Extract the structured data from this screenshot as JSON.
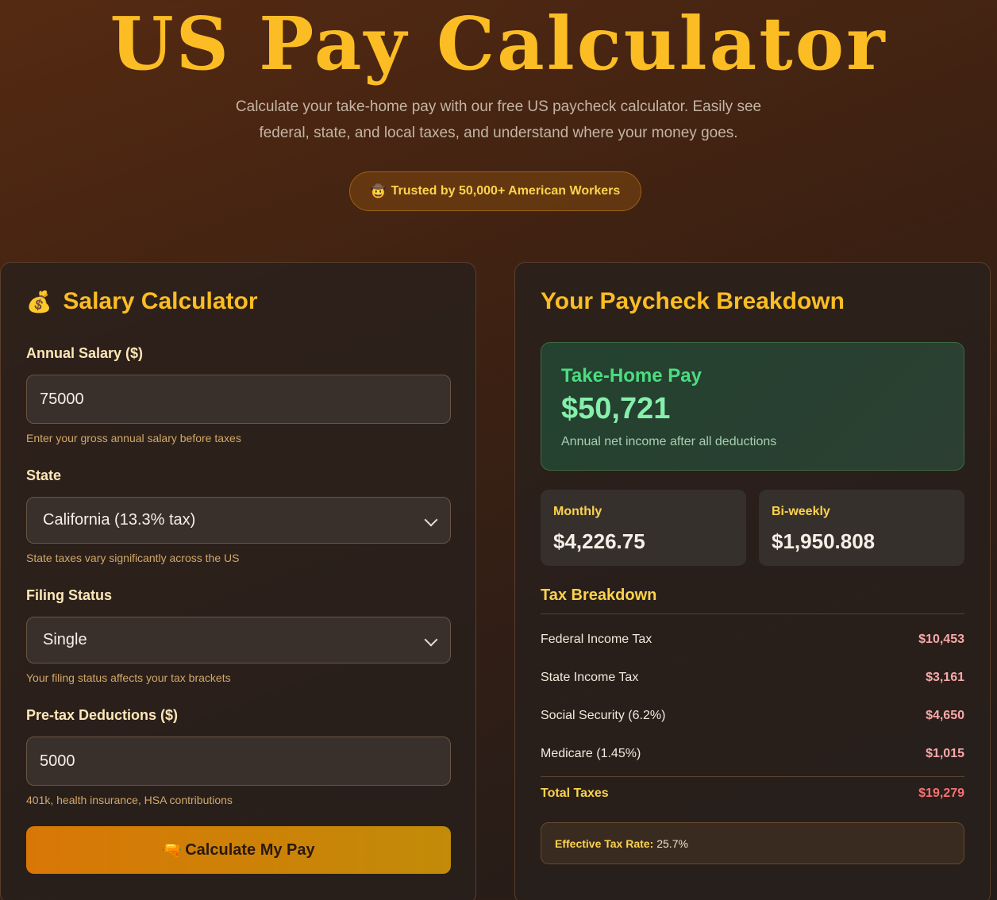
{
  "hero": {
    "title": "US Pay Calculator",
    "subtitle": "Calculate your take-home pay with our free US paycheck calculator. Easily see federal, state, and local taxes, and understand where your money goes.",
    "badge_icon": "🤠",
    "badge_text": "Trusted by 50,000+ American Workers"
  },
  "calculator": {
    "icon": "💰",
    "title": "Salary Calculator",
    "salary": {
      "label": "Annual Salary ($)",
      "value": "75000",
      "hint": "Enter your gross annual salary before taxes"
    },
    "state": {
      "label": "State",
      "selected": "California (13.3% tax)",
      "hint": "State taxes vary significantly across the US"
    },
    "filing": {
      "label": "Filing Status",
      "selected": "Single",
      "hint": "Your filing status affects your tax brackets"
    },
    "deductions": {
      "label": "Pre-tax Deductions ($)",
      "value": "5000",
      "hint": "401k, health insurance, HSA contributions"
    },
    "button_icon": "🔫",
    "button_label": "Calculate My Pay"
  },
  "breakdown": {
    "title": "Your Paycheck Breakdown",
    "takehome": {
      "label": "Take-Home Pay",
      "value": "$50,721",
      "desc": "Annual net income after all deductions"
    },
    "monthly": {
      "label": "Monthly",
      "value": "$4,226.75"
    },
    "biweekly": {
      "label": "Bi-weekly",
      "value": "$1,950.808"
    },
    "tax_title": "Tax Breakdown",
    "taxes": [
      {
        "label": "Federal Income Tax",
        "amount": "$10,453"
      },
      {
        "label": "State Income Tax",
        "amount": "$3,161"
      },
      {
        "label": "Social Security (6.2%)",
        "amount": "$4,650"
      },
      {
        "label": "Medicare (1.45%)",
        "amount": "$1,015"
      }
    ],
    "total": {
      "label": "Total Taxes",
      "amount": "$19,279"
    },
    "effective_rate_label": "Effective Tax Rate:",
    "effective_rate_value": "25.7%"
  },
  "colors": {
    "accent": "#fbbd23",
    "positive": "#4ade80",
    "tax": "#f9a8a8",
    "button": "#d97706"
  }
}
